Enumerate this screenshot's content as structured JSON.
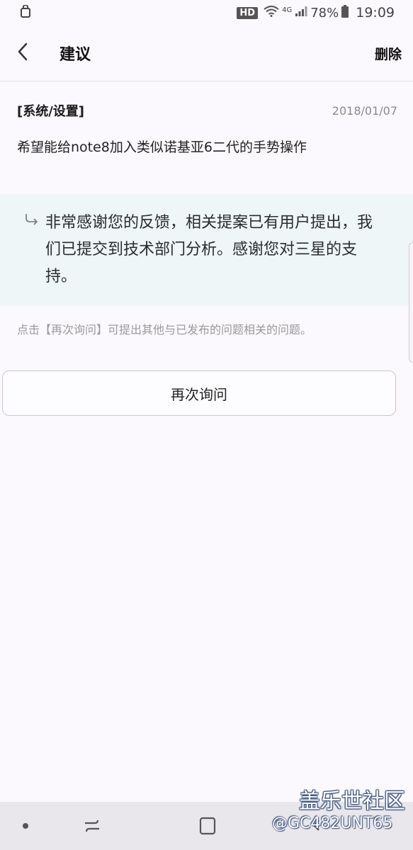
{
  "status_bar": {
    "hd": "HD",
    "network": "4G",
    "battery": "78%",
    "time": "19:09"
  },
  "header": {
    "title": "建议",
    "delete_label": "删除"
  },
  "question": {
    "category": "[系统/设置]",
    "date": "2018/01/07",
    "text": "希望能给note8加入类似诺基亚6二代的手势操作"
  },
  "answer": {
    "text": "非常感谢您的反馈，相关提案已有用户提出，我们已提交到技术部门分析。感谢您对三星的支持。"
  },
  "hint": "点击【再次询问】可提出其他与已发布的问题相关的问题。",
  "ask_again_label": "再次询问",
  "watermark": {
    "brand": "盖乐世社区",
    "id": "@GC482UNT65"
  },
  "icons": {
    "status_left": "shopping-bag-icon",
    "wifi": "wifi-icon",
    "signal": "signal-icon",
    "battery": "battery-icon",
    "back": "back-chevron-icon",
    "reply": "reply-arrow-icon",
    "nav_dot": "nav-dot-icon",
    "nav_recent": "recent-apps-icon",
    "nav_home": "home-icon",
    "nav_back": "nav-back-icon"
  }
}
